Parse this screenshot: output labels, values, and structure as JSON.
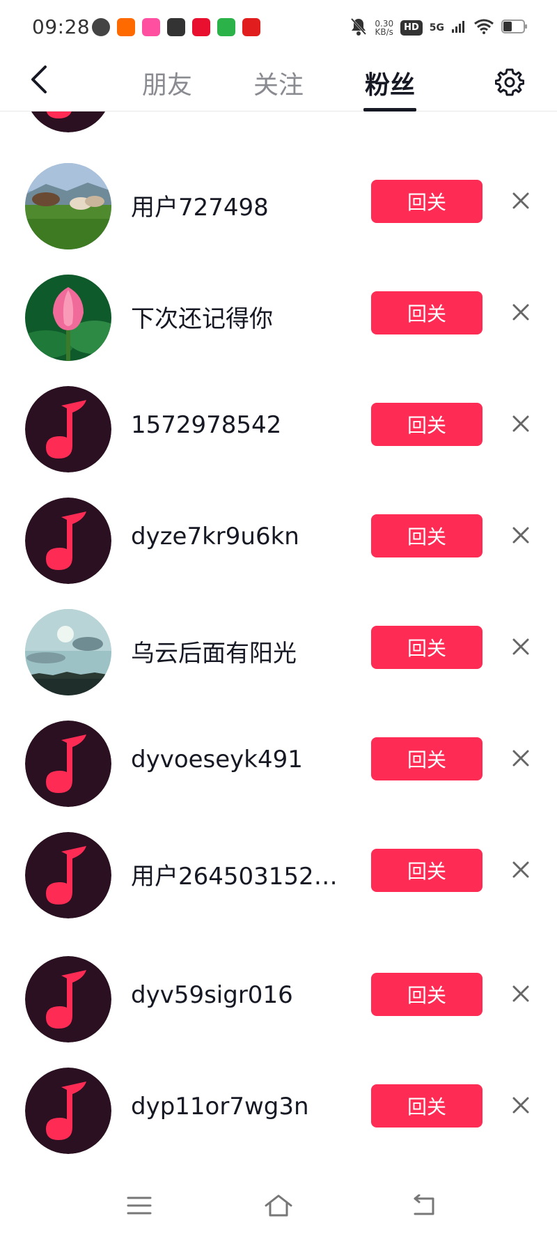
{
  "status_bar": {
    "time": "09:28",
    "speed_value": "0.30",
    "speed_unit": "KB/s",
    "hd": "HD",
    "network": "5G"
  },
  "nav": {
    "tabs": [
      {
        "label": "朋友",
        "active": false
      },
      {
        "label": "关注",
        "active": false
      },
      {
        "label": "粉丝",
        "active": true
      }
    ]
  },
  "followers": [
    {
      "name": "",
      "button": "回关",
      "avatar": "music-note"
    },
    {
      "name": "用户727498",
      "button": "回关",
      "avatar": "cows-photo"
    },
    {
      "name": "下次还记得你",
      "button": "回关",
      "avatar": "lotus-photo"
    },
    {
      "name": "1572978542",
      "button": "回关",
      "avatar": "music-note"
    },
    {
      "name": "dyze7kr9u6kn",
      "button": "回关",
      "avatar": "music-note"
    },
    {
      "name": "乌云后面有阳光",
      "button": "回关",
      "avatar": "sky-photo"
    },
    {
      "name": "dyvoeseyk491",
      "button": "回关",
      "avatar": "music-note"
    },
    {
      "name": "用户2645031521…",
      "button": "回关",
      "avatar": "music-note"
    },
    {
      "name": "dyv59sigr016",
      "button": "回关",
      "avatar": "music-note"
    },
    {
      "name": "dyp11or7wg3n",
      "button": "回关",
      "avatar": "music-note"
    }
  ],
  "colors": {
    "accent": "#fe2c55",
    "avatar_bg": "#2a1020"
  },
  "icons": {
    "back": "chevron-left-icon",
    "settings": "gear-icon",
    "remove": "close-icon",
    "sys_menu": "menu-icon",
    "sys_home": "home-icon",
    "sys_back": "back-arrow-icon"
  }
}
